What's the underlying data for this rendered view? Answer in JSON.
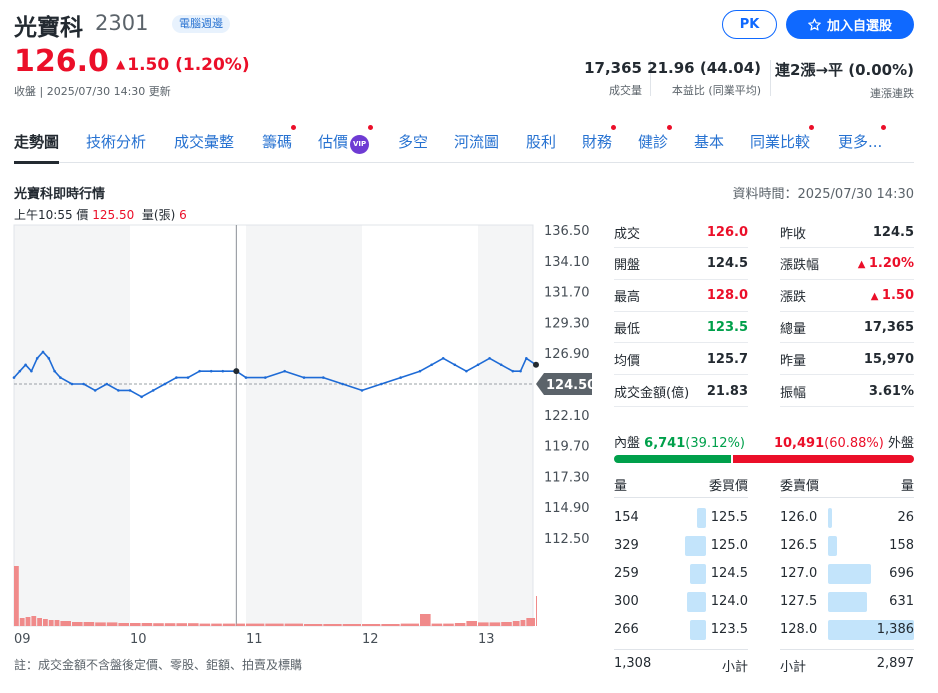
{
  "header": {
    "stock_name": "光寶科",
    "stock_code": "2301",
    "tag": "電腦週邊",
    "price": "126.0",
    "change": "1.50 (1.20%)",
    "status": "收盤 | 2025/07/30 14:30 更新",
    "pk_label": "PK",
    "watchlist_label": "加入自選股",
    "stats": [
      {
        "value": "17,365",
        "label": "成交量"
      },
      {
        "value": "21.96 (44.04)",
        "label": "本益比 (同業平均)"
      },
      {
        "value": "連2漲→平 (0.00%)",
        "label": "連漲連跌"
      }
    ]
  },
  "tabs": [
    {
      "label": "走勢圖",
      "active": true,
      "dot": false
    },
    {
      "label": "技術分析",
      "dot": false
    },
    {
      "label": "成交彙整",
      "dot": false
    },
    {
      "label": "籌碼",
      "dot": true
    },
    {
      "label": "估價",
      "dot": true,
      "vip": "VIP"
    },
    {
      "label": "多空",
      "dot": false
    },
    {
      "label": "河流圖",
      "dot": false
    },
    {
      "label": "股利",
      "dot": false
    },
    {
      "label": "財務",
      "dot": true
    },
    {
      "label": "健診",
      "dot": true
    },
    {
      "label": "基本",
      "dot": false
    },
    {
      "label": "同業比較",
      "dot": true
    },
    {
      "label": "更多...",
      "dot": true
    }
  ],
  "section": {
    "title": "光寶科即時行情",
    "data_time": "資料時間：2025/07/30 14:30",
    "tick_time": "上午10:55",
    "tick_price_label": "價",
    "tick_price": "125.50",
    "tick_volume_label": "量(張)",
    "tick_volume": "6"
  },
  "chart_data": {
    "type": "line",
    "title": "",
    "y_ticks": [
      "136.50",
      "134.10",
      "131.70",
      "129.30",
      "126.90",
      "124.50",
      "122.10",
      "119.70",
      "117.30",
      "114.90",
      "112.50"
    ],
    "ylim": [
      112.5,
      136.5
    ],
    "x_ticks": [
      "09",
      "10",
      "11",
      "12",
      "13"
    ],
    "reference_price": 124.5,
    "reference_label": "124.50",
    "grid": true,
    "series": [
      {
        "x": [
          "09:00",
          "09:03",
          "09:06",
          "09:09",
          "09:12",
          "09:15",
          "09:18",
          "09:21",
          "09:24",
          "09:30",
          "09:36",
          "09:42",
          "09:48",
          "09:54",
          "10:00",
          "10:06",
          "10:12",
          "10:18",
          "10:24",
          "10:30",
          "10:36",
          "10:42",
          "10:48",
          "10:55",
          "11:00",
          "11:10",
          "11:20",
          "11:30",
          "11:40",
          "11:50",
          "12:00",
          "12:10",
          "12:20",
          "12:30",
          "12:36",
          "12:42",
          "12:48",
          "12:54",
          "13:00",
          "13:06",
          "13:12",
          "13:18",
          "13:22",
          "13:25",
          "13:30"
        ],
        "values": [
          125.0,
          125.5,
          126.0,
          125.5,
          126.5,
          127.0,
          126.5,
          125.5,
          125.0,
          124.5,
          124.5,
          124.0,
          124.5,
          124.0,
          124.0,
          123.5,
          124.0,
          124.5,
          125.0,
          125.0,
          125.5,
          125.5,
          125.5,
          125.5,
          125.0,
          125.0,
          125.5,
          125.0,
          125.0,
          124.5,
          124.0,
          124.5,
          125.0,
          125.5,
          126.0,
          126.5,
          126.0,
          125.5,
          126.0,
          126.5,
          126.0,
          125.5,
          125.5,
          126.5,
          126.0
        ]
      },
      {
        "name": "volume",
        "values": [
          300,
          40,
          45,
          50,
          40,
          35,
          30,
          30,
          25,
          20,
          20,
          18,
          18,
          15,
          15,
          15,
          14,
          14,
          14,
          14,
          12,
          12,
          12,
          12,
          12,
          12,
          12,
          10,
          10,
          10,
          10,
          10,
          12,
          60,
          12,
          12,
          15,
          25,
          18,
          18,
          20,
          25,
          30,
          40,
          150
        ]
      }
    ]
  },
  "quote": {
    "left": [
      {
        "key": "成交",
        "value": "126.0",
        "color": "red"
      },
      {
        "key": "開盤",
        "value": "124.5",
        "color": "black"
      },
      {
        "key": "最高",
        "value": "128.0",
        "color": "red"
      },
      {
        "key": "最低",
        "value": "123.5",
        "color": "green"
      },
      {
        "key": "均價",
        "value": "125.7",
        "color": "black"
      },
      {
        "key": "成交金額(億)",
        "value": "21.83",
        "color": "black"
      }
    ],
    "right": [
      {
        "key": "昨收",
        "value": "124.5",
        "color": "black"
      },
      {
        "key": "漲跌幅",
        "value": "1.20%",
        "color": "red",
        "arrow": true
      },
      {
        "key": "漲跌",
        "value": "1.50",
        "color": "red",
        "arrow": true
      },
      {
        "key": "總量",
        "value": "17,365",
        "color": "black"
      },
      {
        "key": "昨量",
        "value": "15,970",
        "color": "black"
      },
      {
        "key": "振幅",
        "value": "3.61%",
        "color": "black"
      }
    ]
  },
  "inner_outer": {
    "inner_label": "內盤",
    "inner_value": "6,741",
    "inner_pct": "(39.12%)",
    "inner_fraction": 0.3912,
    "outer_value": "10,491",
    "outer_pct": "(60.88%)",
    "outer_label": "外盤",
    "inner_color": "#00a04b",
    "outer_color": "#eb0f29"
  },
  "order_book": {
    "bid_headers": [
      "量",
      "委買價"
    ],
    "ask_headers": [
      "委賣價",
      "量"
    ],
    "bids": [
      {
        "volume": "154",
        "price": "125.5",
        "level": 0.11
      },
      {
        "volume": "329",
        "price": "125.0",
        "level": 0.24
      },
      {
        "volume": "259",
        "price": "124.5",
        "level": 0.19
      },
      {
        "volume": "300",
        "price": "124.0",
        "level": 0.22
      },
      {
        "volume": "266",
        "price": "123.5",
        "level": 0.19
      }
    ],
    "asks": [
      {
        "price": "126.0",
        "volume": "26",
        "level": 0.02
      },
      {
        "price": "126.5",
        "volume": "158",
        "level": 0.11
      },
      {
        "price": "127.0",
        "volume": "696",
        "level": 0.5
      },
      {
        "price": "127.5",
        "volume": "631",
        "level": 0.45
      },
      {
        "price": "128.0",
        "volume": "1,386",
        "level": 1.0
      }
    ],
    "bid_total": "1,308",
    "bid_total_label": "小計",
    "ask_total_label": "小計",
    "ask_total": "2,897"
  },
  "note": "註：成交金額不含盤後定價、零股、鉅額、拍賣及標購",
  "colors": {
    "accent": "#0f69ff",
    "up": "#eb0f29",
    "down": "#00a04b",
    "line": "#1e6bd6",
    "volume": "#f08a8a"
  }
}
